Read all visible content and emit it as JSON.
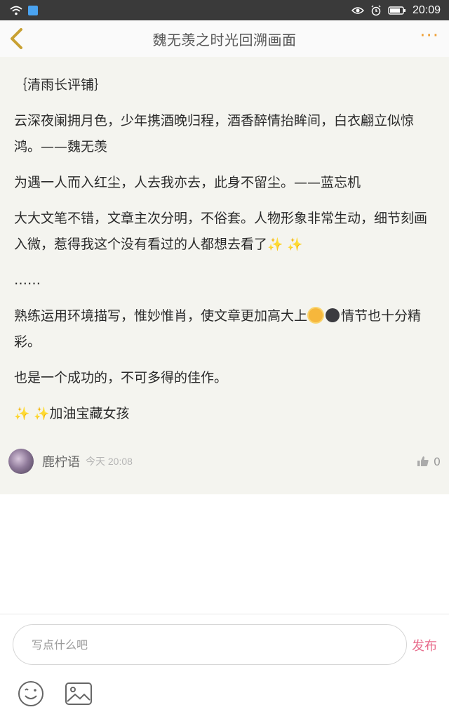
{
  "status_bar": {
    "time": "20:09"
  },
  "header": {
    "title": "魏无羡之时光回溯画面",
    "more_label": "···"
  },
  "comment": {
    "heading": "｛清雨长评铺｝",
    "paragraph1": "云深夜阑拥月色，少年携酒晚归程，酒香醉情抬眸间，白衣翩立似惊鸿。——魏无羡",
    "paragraph2": "为遇一人而入红尘，人去我亦去，此身不留尘。——蓝忘机",
    "paragraph3": "大大文笔不错，文章主次分明，不俗套。人物形象非常生动，细节刻画入微，惹得我这个没有看过的人都想去看了",
    "ellipsis": "……",
    "paragraph4a": "熟练运用环境描写，惟妙惟肖，使文章更加高大上",
    "paragraph4b": "情节也十分精彩。",
    "paragraph5": "也是一个成功的，不可多得的佳作。",
    "paragraph6": "加油宝藏女孩",
    "author": {
      "name": "鹿柠语",
      "time": "今天 20:08"
    },
    "likes": "0"
  },
  "composer": {
    "placeholder": "写点什么吧",
    "send_label": "发布"
  },
  "colors": {
    "accent_orange": "#f0a23a",
    "send_pink": "#e86c8c",
    "card_bg": "#f4f4ef"
  }
}
